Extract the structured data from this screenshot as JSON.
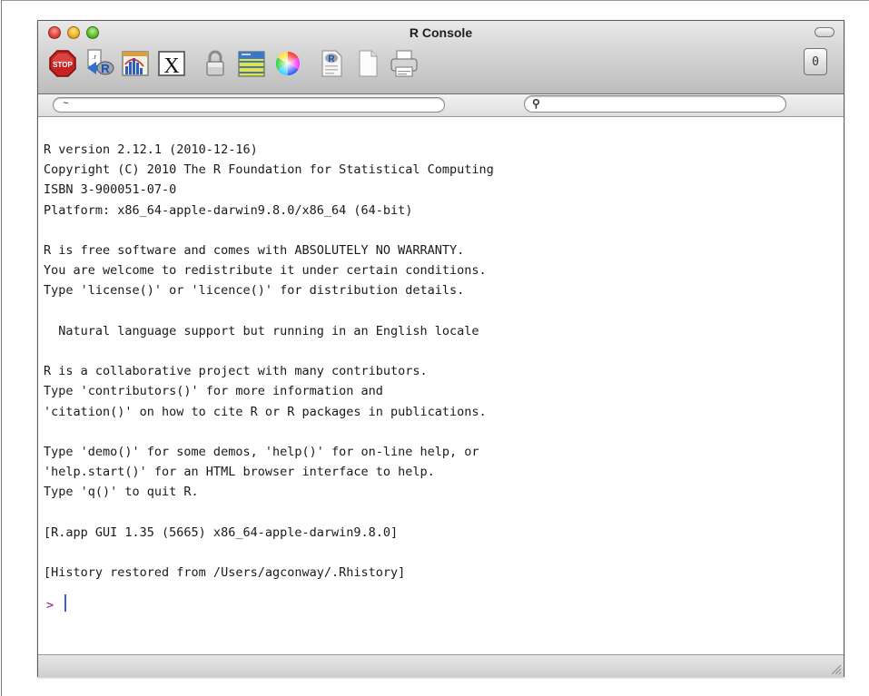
{
  "window": {
    "title": "R Console"
  },
  "toolbar": {
    "buttons": [
      {
        "name": "stop-icon",
        "label": "STOP"
      },
      {
        "name": "source-script-icon",
        "label": ""
      },
      {
        "name": "quartz-plot-icon",
        "label": ""
      },
      {
        "name": "x11-icon",
        "label": "X"
      },
      {
        "name": "authorize-lock-icon",
        "label": ""
      },
      {
        "name": "show-history-icon",
        "label": ""
      },
      {
        "name": "color-wheel-icon",
        "label": ""
      },
      {
        "name": "open-document-icon",
        "label": ""
      },
      {
        "name": "new-document-icon",
        "label": ""
      },
      {
        "name": "print-icon",
        "label": ""
      }
    ],
    "drawer_label": "0"
  },
  "pathbar": {
    "working_directory": "~",
    "search_value": "",
    "search_placeholder": ""
  },
  "console": {
    "text": "R version 2.12.1 (2010-12-16)\nCopyright (C) 2010 The R Foundation for Statistical Computing\nISBN 3-900051-07-0\nPlatform: x86_64-apple-darwin9.8.0/x86_64 (64-bit)\n\nR is free software and comes with ABSOLUTELY NO WARRANTY.\nYou are welcome to redistribute it under certain conditions.\nType 'license()' or 'licence()' for distribution details.\n\n  Natural language support but running in an English locale\n\nR is a collaborative project with many contributors.\nType 'contributors()' for more information and\n'citation()' on how to cite R or R packages in publications.\n\nType 'demo()' for some demos, 'help()' for on-line help, or\n'help.start()' for an HTML browser interface to help.\nType 'q()' to quit R.\n\n[R.app GUI 1.35 (5665) x86_64-apple-darwin9.8.0]\n\n[History restored from /Users/agconway/.Rhistory]",
    "prompt": ">"
  },
  "colors": {
    "prompt": "#8a1a8a",
    "caret": "#3a5fd8"
  }
}
